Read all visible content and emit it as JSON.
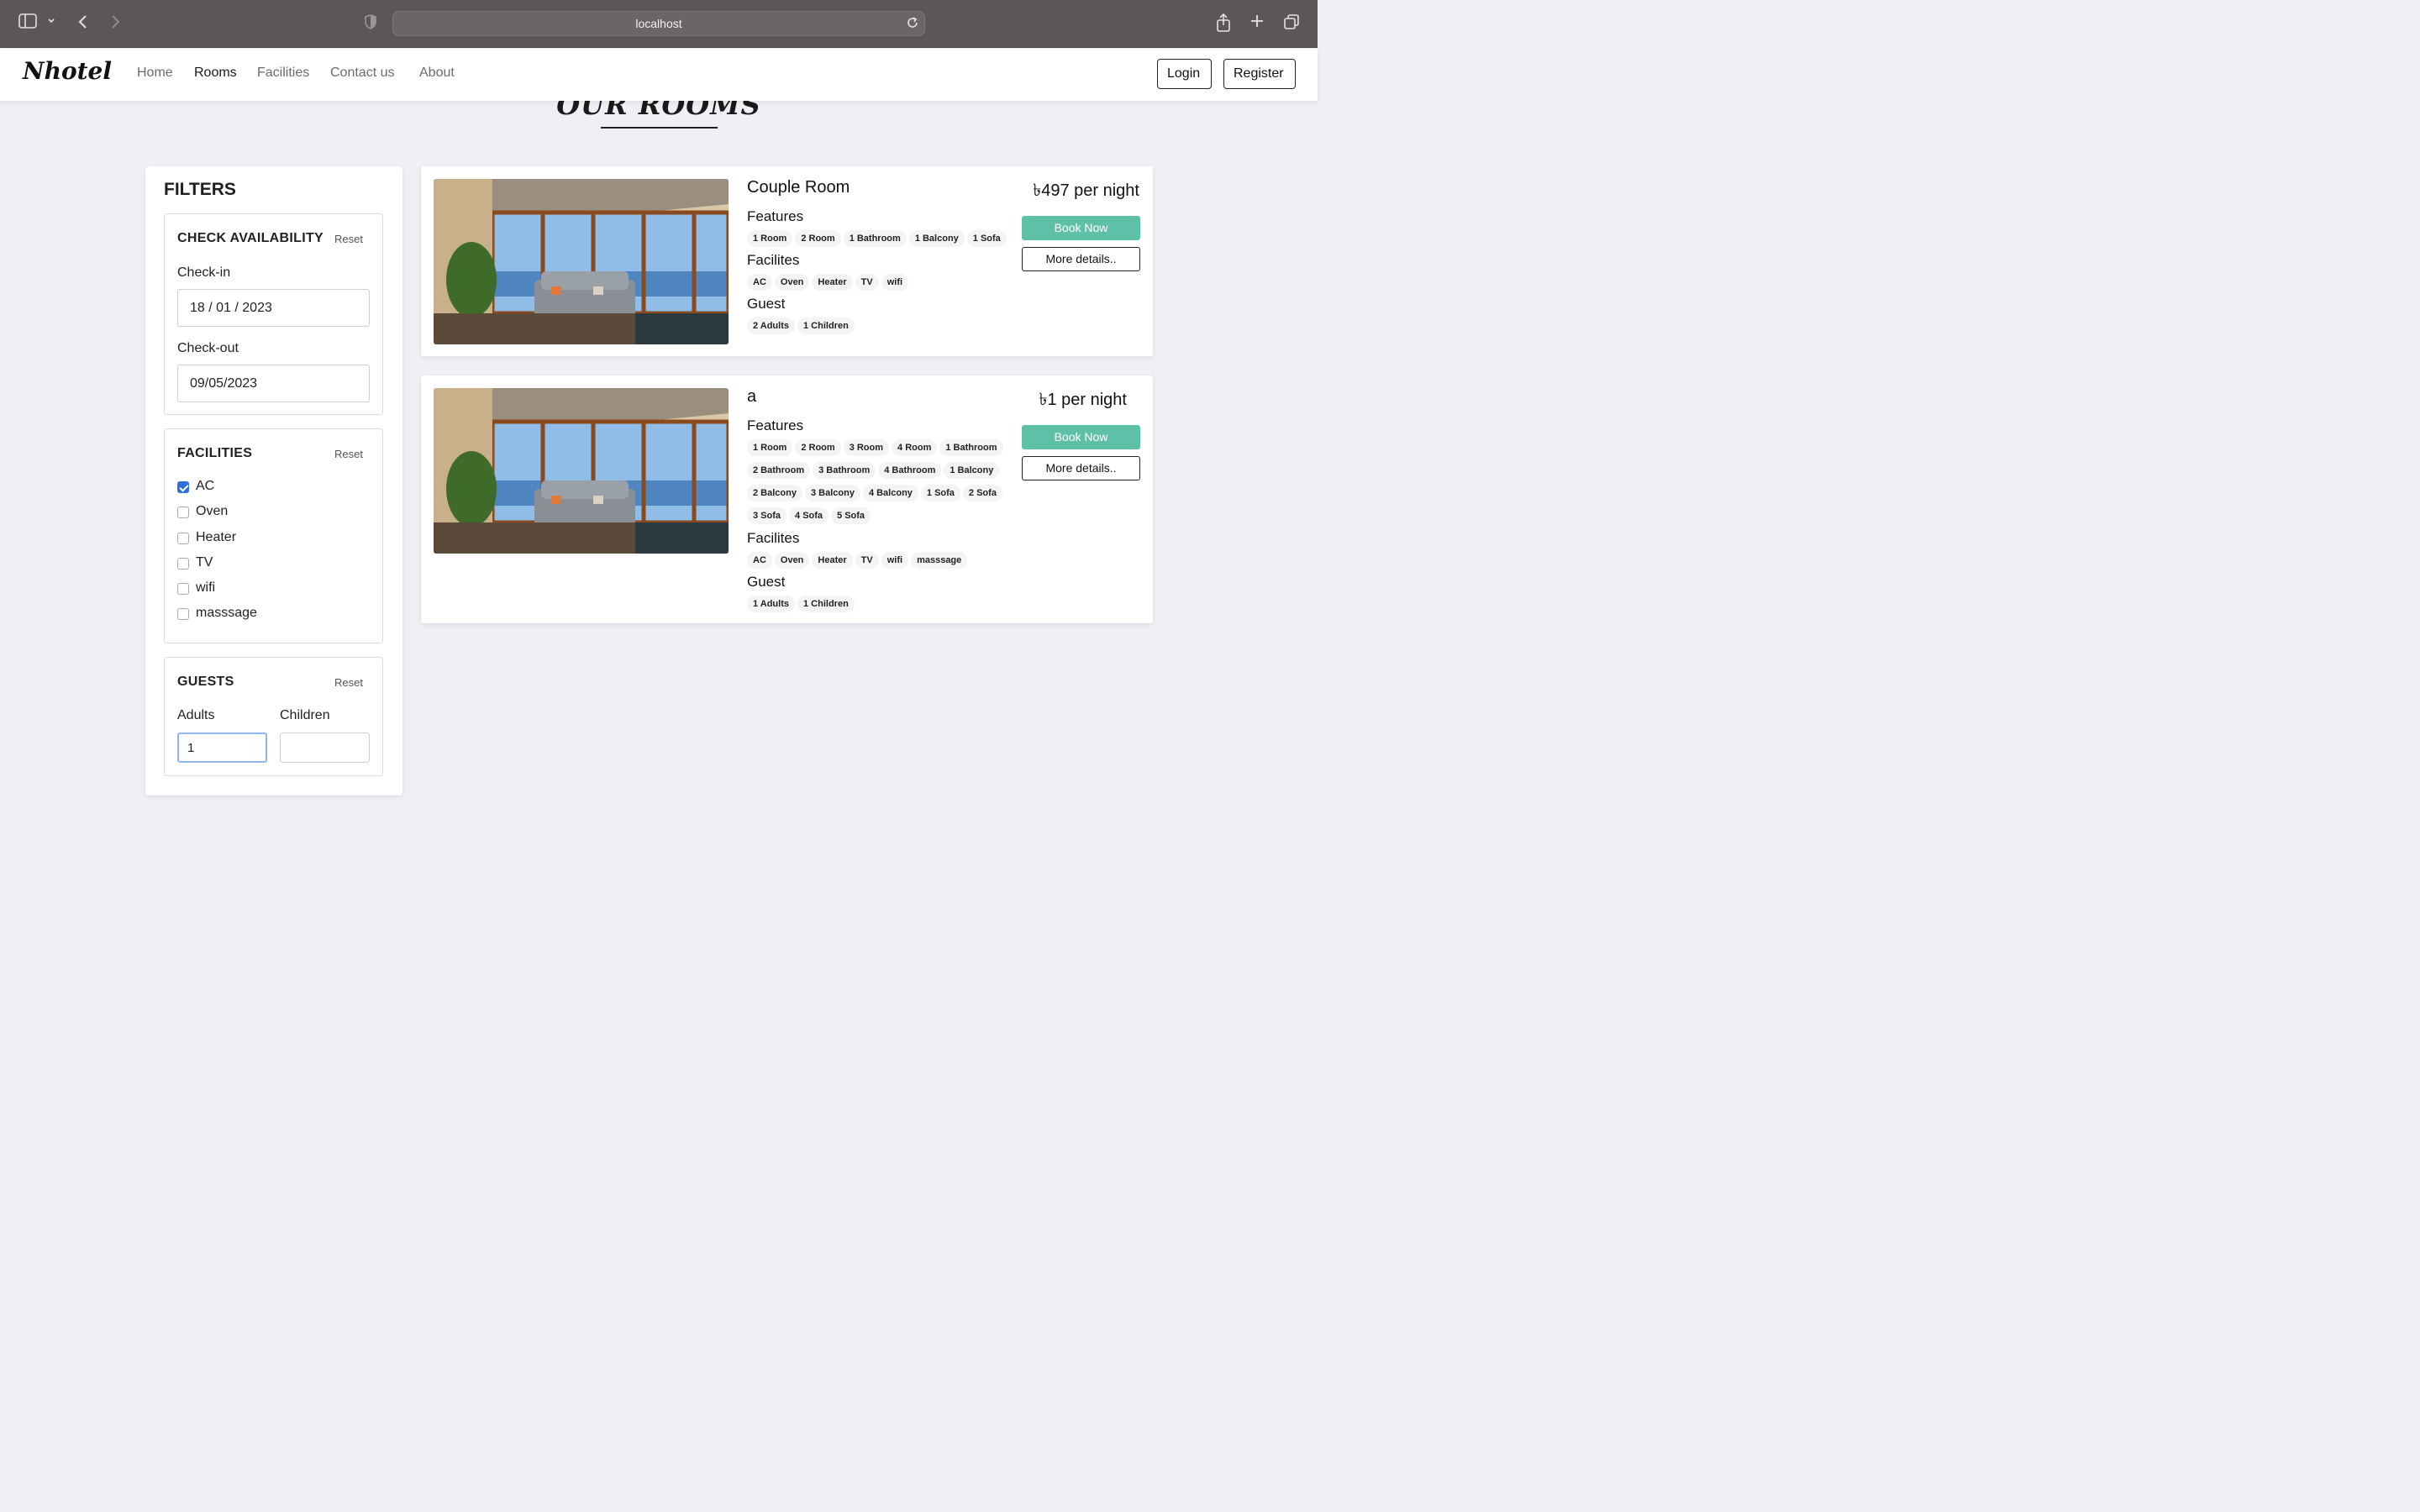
{
  "browser": {
    "url": "localhost",
    "icons": [
      "sidebar-icon",
      "chevron-down-icon",
      "back-icon",
      "forward-icon",
      "shield-icon",
      "reload-icon",
      "share-icon",
      "new-tab-icon",
      "tabs-overview-icon"
    ]
  },
  "navbar": {
    "brand": "Nhotel",
    "links": [
      "Home",
      "Rooms",
      "Facilities",
      "Contact us",
      "About"
    ],
    "active_link": "Rooms",
    "login": "Login",
    "register": "Register"
  },
  "page": {
    "heading": "OUR ROOMS"
  },
  "filters": {
    "title": "FILTERS",
    "availability": {
      "title": "CHECK AVAILABILITY",
      "reset": "Reset",
      "checkin_label": "Check-in",
      "checkin_value": "18 / 01 / 2023",
      "checkout_label": "Check-out",
      "checkout_value": "09/05/2023"
    },
    "facilities": {
      "title": "FACILITIES",
      "reset": "Reset",
      "options": [
        {
          "label": "AC",
          "checked": true
        },
        {
          "label": "Oven",
          "checked": false
        },
        {
          "label": "Heater",
          "checked": false
        },
        {
          "label": "TV",
          "checked": false
        },
        {
          "label": "wifi",
          "checked": false
        },
        {
          "label": "masssage",
          "checked": false
        }
      ]
    },
    "guests": {
      "title": "GUESTS",
      "reset": "Reset",
      "adults_label": "Adults",
      "adults_value": "1",
      "children_label": "Children",
      "children_value": ""
    }
  },
  "rooms": [
    {
      "name": "Couple Room",
      "price": "৳497 per night",
      "features_title": "Features",
      "features": [
        [
          "1 Room",
          "2 Room",
          "1 Bathroom",
          "1 Balcony",
          "1 Sofa"
        ]
      ],
      "facilities_title": "Facilites",
      "facilities": [
        "AC",
        "Oven",
        "Heater",
        "TV",
        "wifi"
      ],
      "guest_title": "Guest",
      "guests": [
        "2 Adults",
        "1 Children"
      ],
      "book_label": "Book Now",
      "details_label": "More details.."
    },
    {
      "name": "a",
      "price": "৳1 per night",
      "features_title": "Features",
      "features": [
        [
          "1 Room",
          "2 Room",
          "3 Room",
          "4 Room",
          "1 Bathroom"
        ],
        [
          "2 Bathroom",
          "3 Bathroom",
          "4 Bathroom",
          "1 Balcony"
        ],
        [
          "2 Balcony",
          "3 Balcony",
          "4 Balcony",
          "1 Sofa",
          "2 Sofa"
        ],
        [
          "3 Sofa",
          "4 Sofa",
          "5 Sofa"
        ]
      ],
      "facilities_title": "Facilites",
      "facilities": [
        "AC",
        "Oven",
        "Heater",
        "TV",
        "wifi",
        "masssage"
      ],
      "guest_title": "Guest",
      "guests": [
        "1 Adults",
        "1 Children"
      ],
      "book_label": "Book Now",
      "details_label": "More details.."
    }
  ],
  "colors": {
    "accent": "#5fc0a8",
    "page_bg": "#eef0f5",
    "checkbox_checked": "#2a6fde",
    "browser_chrome": "#5b5756"
  }
}
